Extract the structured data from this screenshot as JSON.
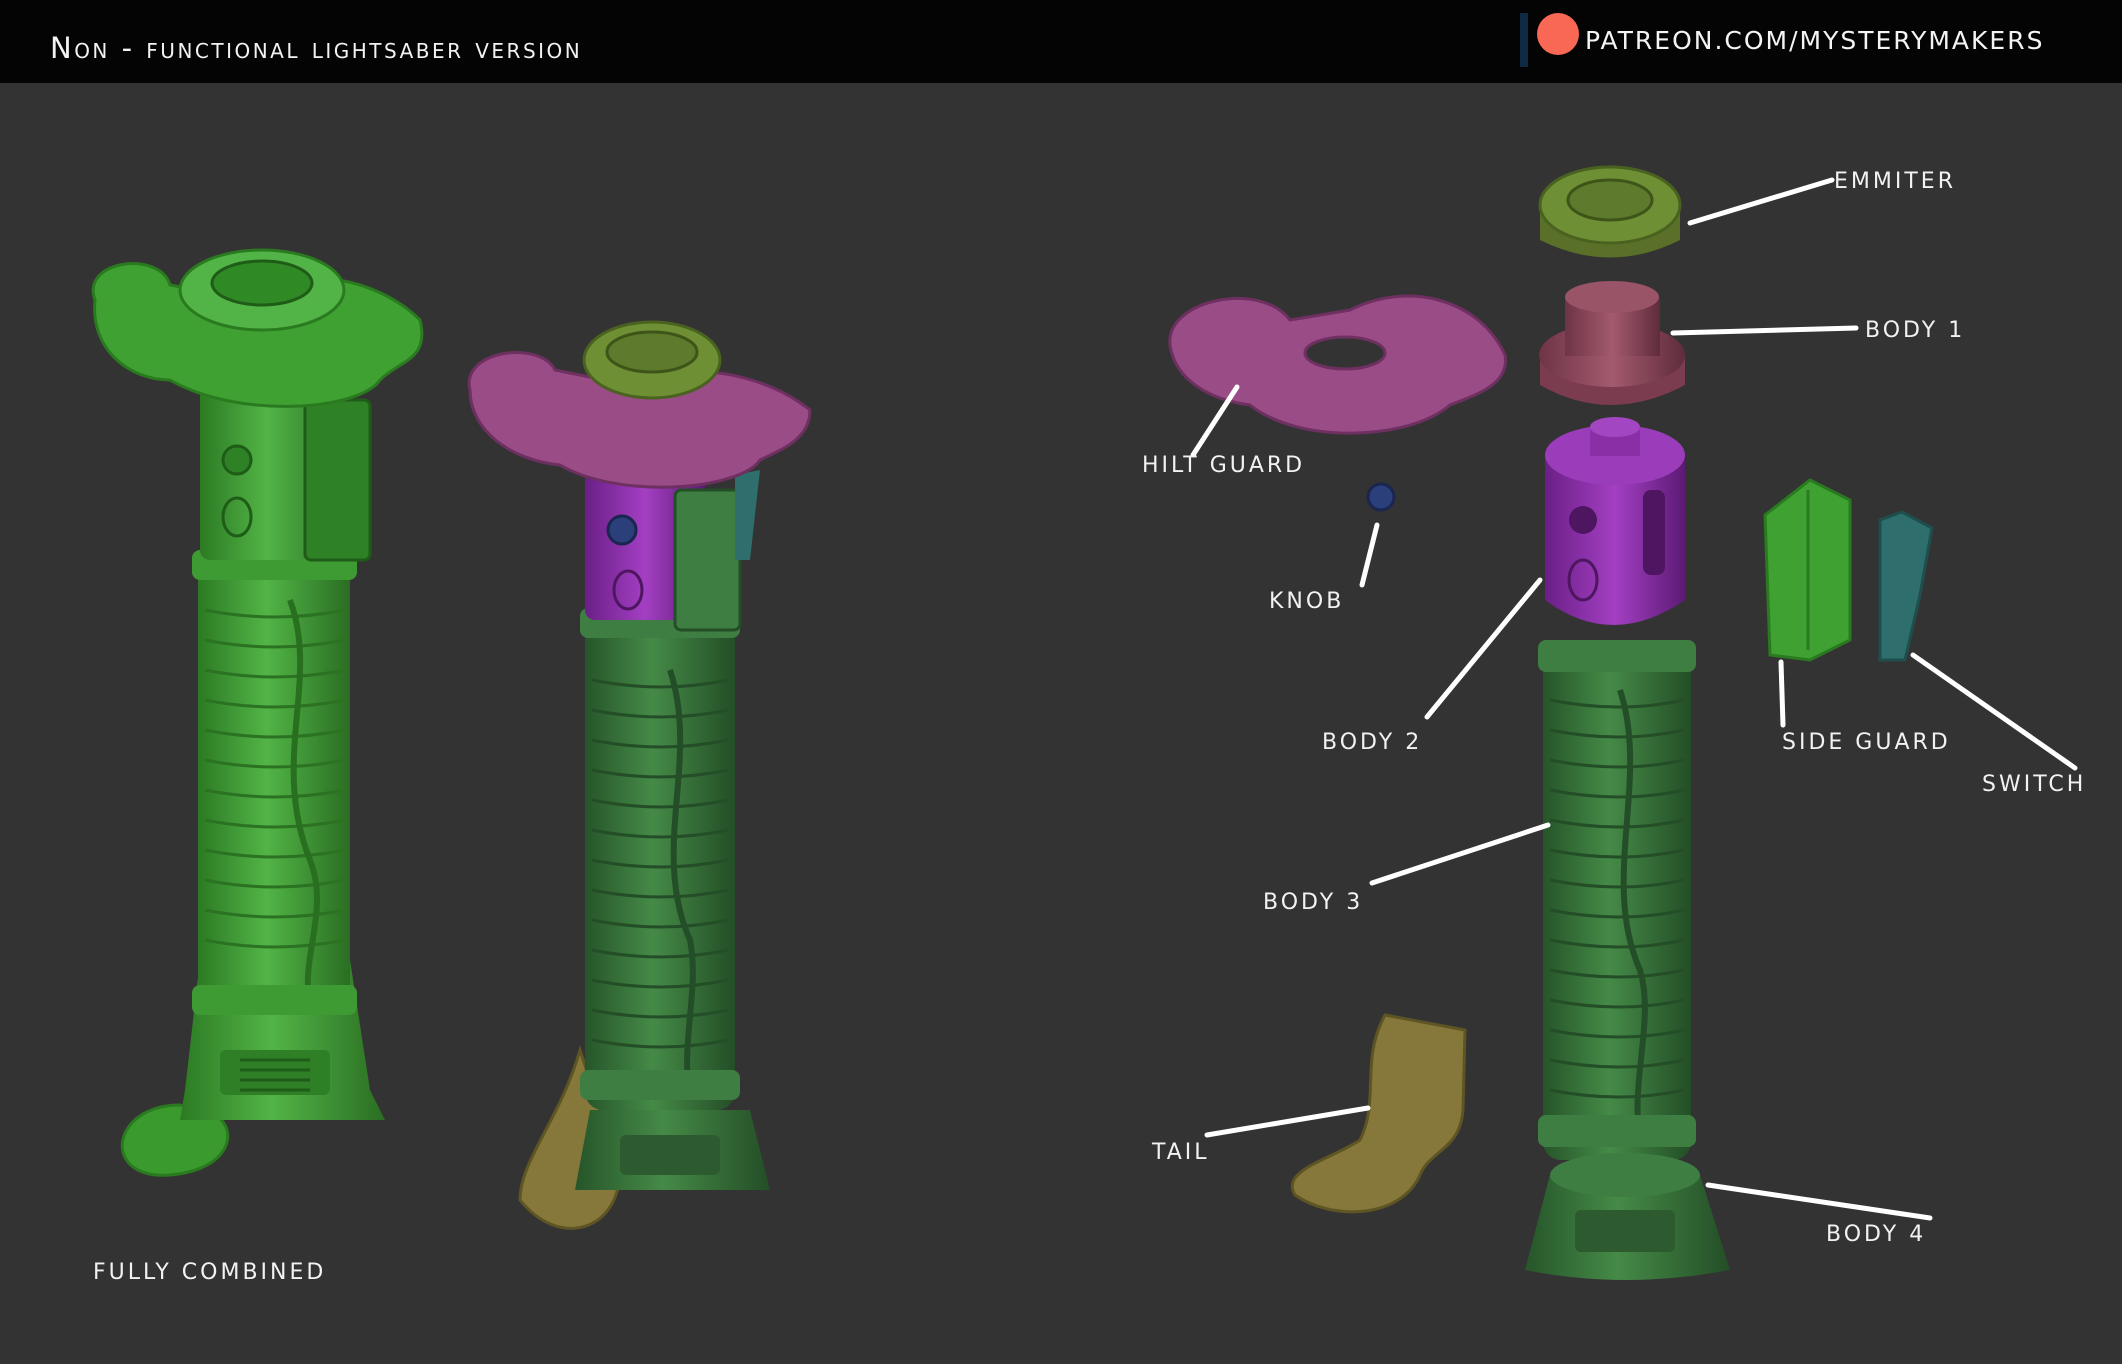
{
  "header": {
    "title": "Non - functional lightsaber version",
    "patreon_url": "PATREON.COM/MYSTERYMAKERS"
  },
  "labels": {
    "fully_combined": "FULLY COMBINED",
    "emmiter": "EMMITER",
    "body_1": "BODY 1",
    "hilt_guard": "HILT GUARD",
    "knob": "KNOB",
    "body_2": "BODY 2",
    "side_guard": "SIDE GUARD",
    "switch": "SWITCH",
    "body_3": "BODY 3",
    "tail": "TAIL",
    "body_4": "BODY 4"
  },
  "colors": {
    "background": "#333333",
    "header": "#040404",
    "green": "#3f9a34",
    "dark_green": "#356c38",
    "olive": "#5f7a2c",
    "mauve": "#9a4c86",
    "rose": "#8c4658",
    "purple": "#8a2fa6",
    "teal": "#2e6e6c",
    "gold": "#86783a",
    "navy": "#2b3f7a",
    "patreon_coral": "#f96854"
  }
}
